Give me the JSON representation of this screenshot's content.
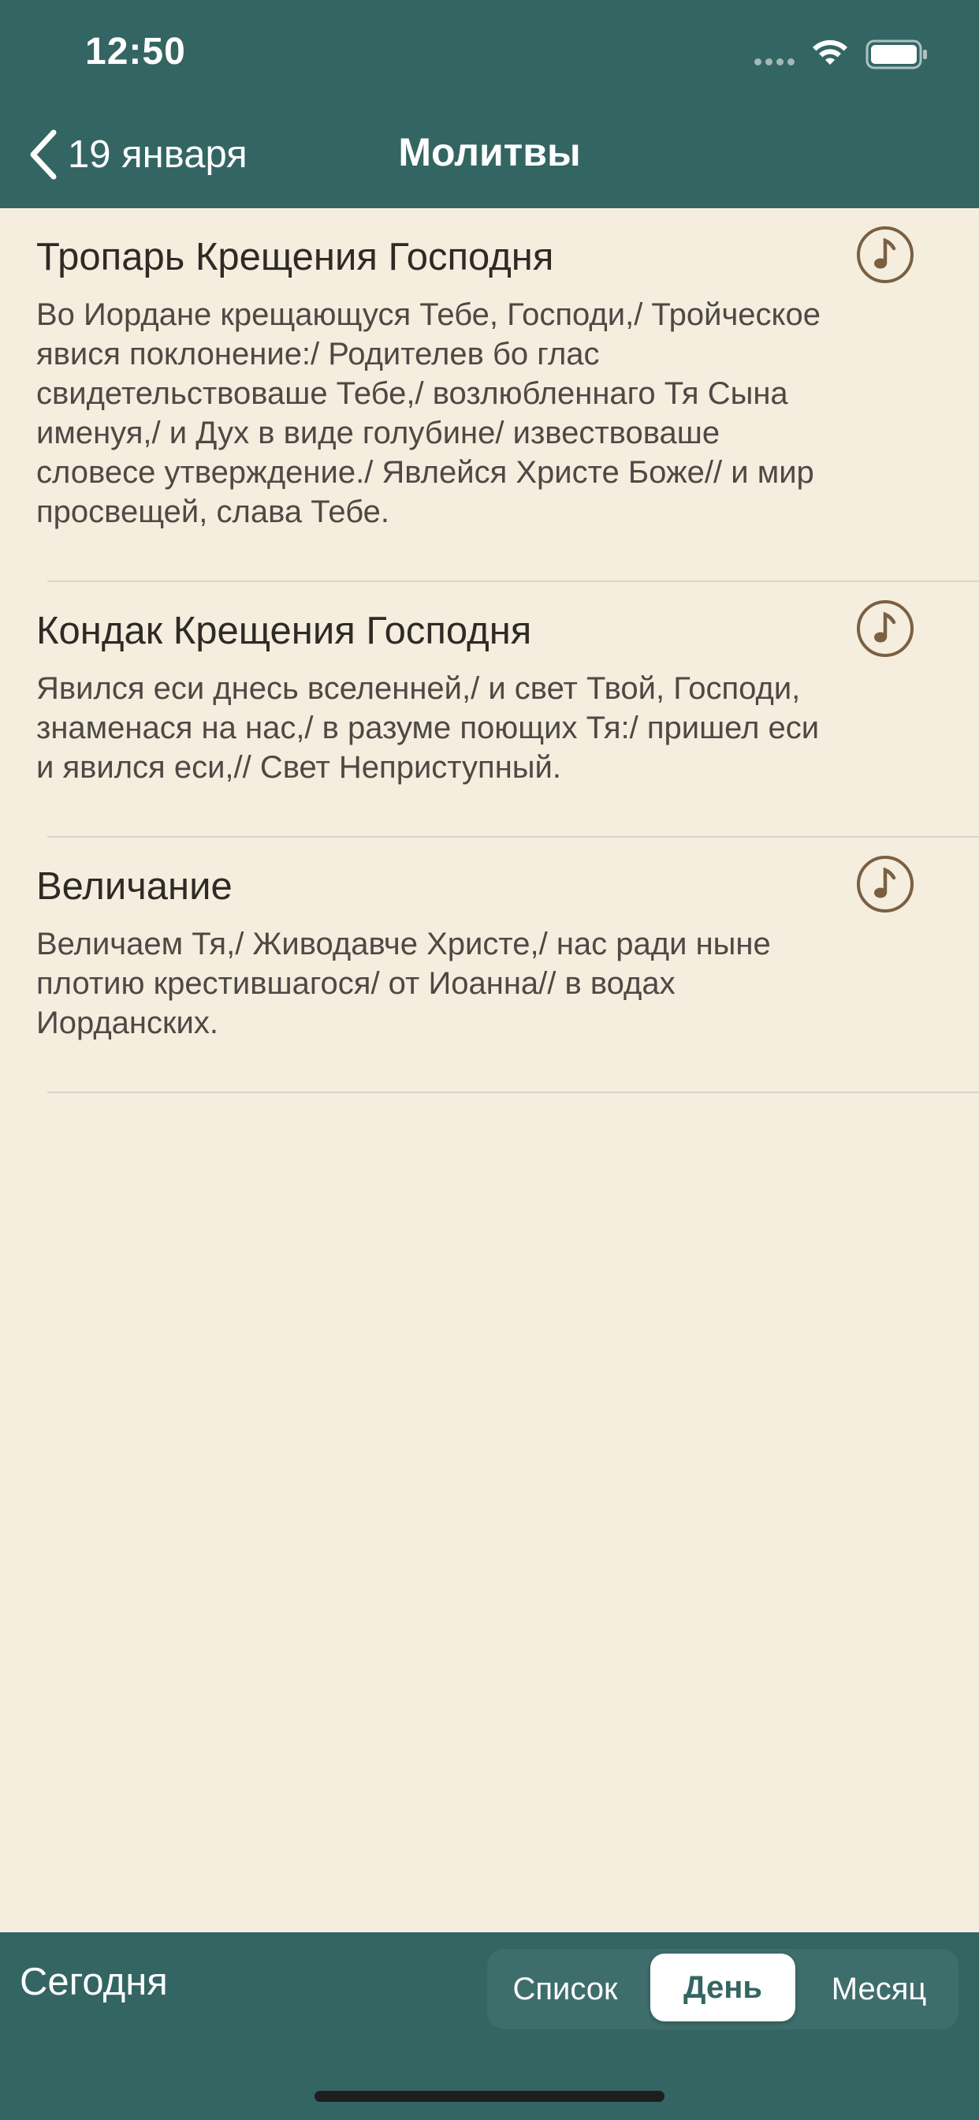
{
  "status_bar": {
    "time": "12:50",
    "icons": [
      "signal-dots-icon",
      "wifi-icon",
      "battery-icon"
    ]
  },
  "nav": {
    "back_label": "19 января",
    "title": "Молитвы"
  },
  "prayers": [
    {
      "title": "Тропарь Крещения Господня",
      "lines": [
        "Во Иордане крещающуся Тебе, Господи,/ Тройческое",
        "явися поклонение:/ Родителев бо глас",
        "свидетельствоваше Тебе,/ возлюбленнаго Тя Сына",
        "именуя,/ и Дух в виде голубине/ извествоваше",
        "словесе утверждение./ Явлейся Христе Боже// и мир",
        "просвещей, слава Тебе."
      ]
    },
    {
      "title": "Кондак Крещения Господня",
      "lines": [
        "Явился еси днесь вселенней,/ и свет Твой, Господи,",
        "знаменася на нас,/ в разуме поющих Тя:/ пришел еси",
        "и явился еси,// Свет Неприступный."
      ]
    },
    {
      "title": "Величание",
      "lines": [
        "Величаем Тя,/ Живодавче Христе,/ нас ради ныне",
        "плотию крестившагося/ от Иоанна// в водах",
        "Иорданских."
      ]
    }
  ],
  "toolbar": {
    "today_label": "Сегодня",
    "segments": [
      "Список",
      "День",
      "Месяц"
    ],
    "selected_segment": "День"
  },
  "colors": {
    "header": "#336563",
    "background": "#F5EEDF",
    "accent_icon": "#7A6043"
  }
}
